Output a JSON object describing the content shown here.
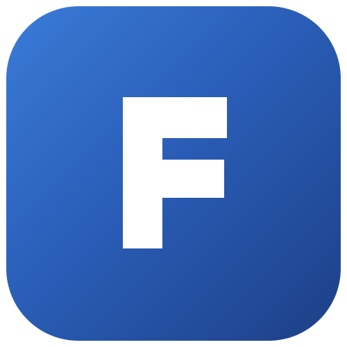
{
  "icon": {
    "letter": "F",
    "background_color_start": "#3a7bd8",
    "background_color_end": "#1d3f86",
    "glyph_color": "#ffffff"
  }
}
